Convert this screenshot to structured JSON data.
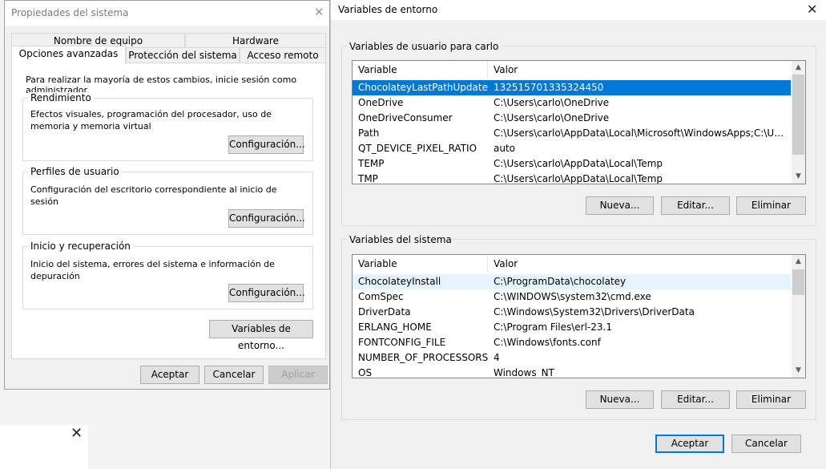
{
  "sys_props": {
    "title": "Propiedades del sistema",
    "tabs_row1": [
      "Nombre de equipo",
      "Hardware"
    ],
    "tabs_row2": [
      "Opciones avanzadas",
      "Protección del sistema",
      "Acceso remoto"
    ],
    "admin_note": "Para realizar la mayoría de estos cambios, inicie sesión como administrador.",
    "groups": [
      {
        "title": "Rendimiento",
        "desc": "Efectos visuales, programación del procesador, uso de memoria y memoria virtual",
        "button": "Configuración..."
      },
      {
        "title": "Perfiles de usuario",
        "desc": "Configuración del escritorio correspondiente al inicio de sesión",
        "button": "Configuración..."
      },
      {
        "title": "Inicio y recuperación",
        "desc": "Inicio del sistema, errores del sistema e información de depuración",
        "button": "Configuración..."
      }
    ],
    "env_button": "Variables de entorno...",
    "ok": "Aceptar",
    "cancel": "Cancelar",
    "apply": "Aplicar"
  },
  "env": {
    "title": "Variables de entorno",
    "user_group_title": "Variables de usuario para carlo",
    "system_group_title": "Variables del sistema",
    "col_variable": "Variable",
    "col_value": "Valor",
    "user_vars": [
      {
        "name": "ChocolateyLastPathUpdate",
        "value": "132515701335324450"
      },
      {
        "name": "OneDrive",
        "value": "C:\\Users\\carlo\\OneDrive"
      },
      {
        "name": "OneDriveConsumer",
        "value": "C:\\Users\\carlo\\OneDrive"
      },
      {
        "name": "Path",
        "value": "C:\\Users\\carlo\\AppData\\Local\\Microsoft\\WindowsApps;C:\\Users\\c..."
      },
      {
        "name": "QT_DEVICE_PIXEL_RATIO",
        "value": "auto"
      },
      {
        "name": "TEMP",
        "value": "C:\\Users\\carlo\\AppData\\Local\\Temp"
      },
      {
        "name": "TMP",
        "value": "C:\\Users\\carlo\\AppData\\Local\\Temp"
      }
    ],
    "system_vars": [
      {
        "name": "ChocolateyInstall",
        "value": "C:\\ProgramData\\chocolatey"
      },
      {
        "name": "ComSpec",
        "value": "C:\\WINDOWS\\system32\\cmd.exe"
      },
      {
        "name": "DriverData",
        "value": "C:\\Windows\\System32\\Drivers\\DriverData"
      },
      {
        "name": "ERLANG_HOME",
        "value": "C:\\Program Files\\erl-23.1"
      },
      {
        "name": "FONTCONFIG_FILE",
        "value": "C:\\Windows\\fonts.conf"
      },
      {
        "name": "NUMBER_OF_PROCESSORS",
        "value": "4"
      },
      {
        "name": "OS",
        "value": "Windows_NT"
      }
    ],
    "user_buttons": {
      "new": "Nueva...",
      "edit": "Editar...",
      "delete": "Eliminar"
    },
    "system_buttons": {
      "new": "Nueva...",
      "edit": "Editar...",
      "delete": "Eliminar"
    },
    "ok": "Aceptar",
    "cancel": "Cancelar"
  },
  "icons": {
    "close": "close-icon",
    "scroll_up": "chevron-up-icon",
    "scroll_down": "chevron-down-icon"
  },
  "colors": {
    "accent": "#0078d7",
    "selection_text": "#ffffff",
    "hover_row": "#e5f3ff"
  }
}
